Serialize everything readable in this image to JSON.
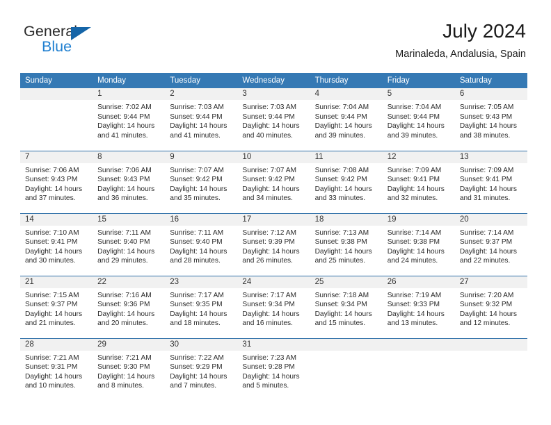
{
  "brand": {
    "name_part1": "General",
    "name_part2": "Blue",
    "accent_color": "#1f7fd0",
    "triangle_color": "#1565a8"
  },
  "header": {
    "title": "July 2024",
    "subtitle": "Marinaleda, Andalusia, Spain"
  },
  "calendar": {
    "header_bg": "#3579b4",
    "daynum_bg": "#f1f1f1",
    "weekdays": [
      "Sunday",
      "Monday",
      "Tuesday",
      "Wednesday",
      "Thursday",
      "Friday",
      "Saturday"
    ],
    "weeks": [
      [
        {
          "day": "",
          "sunrise": "",
          "sunset": "",
          "daylight_1": "",
          "daylight_2": ""
        },
        {
          "day": "1",
          "sunrise": "Sunrise: 7:02 AM",
          "sunset": "Sunset: 9:44 PM",
          "daylight_1": "Daylight: 14 hours",
          "daylight_2": "and 41 minutes."
        },
        {
          "day": "2",
          "sunrise": "Sunrise: 7:03 AM",
          "sunset": "Sunset: 9:44 PM",
          "daylight_1": "Daylight: 14 hours",
          "daylight_2": "and 41 minutes."
        },
        {
          "day": "3",
          "sunrise": "Sunrise: 7:03 AM",
          "sunset": "Sunset: 9:44 PM",
          "daylight_1": "Daylight: 14 hours",
          "daylight_2": "and 40 minutes."
        },
        {
          "day": "4",
          "sunrise": "Sunrise: 7:04 AM",
          "sunset": "Sunset: 9:44 PM",
          "daylight_1": "Daylight: 14 hours",
          "daylight_2": "and 39 minutes."
        },
        {
          "day": "5",
          "sunrise": "Sunrise: 7:04 AM",
          "sunset": "Sunset: 9:44 PM",
          "daylight_1": "Daylight: 14 hours",
          "daylight_2": "and 39 minutes."
        },
        {
          "day": "6",
          "sunrise": "Sunrise: 7:05 AM",
          "sunset": "Sunset: 9:43 PM",
          "daylight_1": "Daylight: 14 hours",
          "daylight_2": "and 38 minutes."
        }
      ],
      [
        {
          "day": "7",
          "sunrise": "Sunrise: 7:06 AM",
          "sunset": "Sunset: 9:43 PM",
          "daylight_1": "Daylight: 14 hours",
          "daylight_2": "and 37 minutes."
        },
        {
          "day": "8",
          "sunrise": "Sunrise: 7:06 AM",
          "sunset": "Sunset: 9:43 PM",
          "daylight_1": "Daylight: 14 hours",
          "daylight_2": "and 36 minutes."
        },
        {
          "day": "9",
          "sunrise": "Sunrise: 7:07 AM",
          "sunset": "Sunset: 9:42 PM",
          "daylight_1": "Daylight: 14 hours",
          "daylight_2": "and 35 minutes."
        },
        {
          "day": "10",
          "sunrise": "Sunrise: 7:07 AM",
          "sunset": "Sunset: 9:42 PM",
          "daylight_1": "Daylight: 14 hours",
          "daylight_2": "and 34 minutes."
        },
        {
          "day": "11",
          "sunrise": "Sunrise: 7:08 AM",
          "sunset": "Sunset: 9:42 PM",
          "daylight_1": "Daylight: 14 hours",
          "daylight_2": "and 33 minutes."
        },
        {
          "day": "12",
          "sunrise": "Sunrise: 7:09 AM",
          "sunset": "Sunset: 9:41 PM",
          "daylight_1": "Daylight: 14 hours",
          "daylight_2": "and 32 minutes."
        },
        {
          "day": "13",
          "sunrise": "Sunrise: 7:09 AM",
          "sunset": "Sunset: 9:41 PM",
          "daylight_1": "Daylight: 14 hours",
          "daylight_2": "and 31 minutes."
        }
      ],
      [
        {
          "day": "14",
          "sunrise": "Sunrise: 7:10 AM",
          "sunset": "Sunset: 9:41 PM",
          "daylight_1": "Daylight: 14 hours",
          "daylight_2": "and 30 minutes."
        },
        {
          "day": "15",
          "sunrise": "Sunrise: 7:11 AM",
          "sunset": "Sunset: 9:40 PM",
          "daylight_1": "Daylight: 14 hours",
          "daylight_2": "and 29 minutes."
        },
        {
          "day": "16",
          "sunrise": "Sunrise: 7:11 AM",
          "sunset": "Sunset: 9:40 PM",
          "daylight_1": "Daylight: 14 hours",
          "daylight_2": "and 28 minutes."
        },
        {
          "day": "17",
          "sunrise": "Sunrise: 7:12 AM",
          "sunset": "Sunset: 9:39 PM",
          "daylight_1": "Daylight: 14 hours",
          "daylight_2": "and 26 minutes."
        },
        {
          "day": "18",
          "sunrise": "Sunrise: 7:13 AM",
          "sunset": "Sunset: 9:38 PM",
          "daylight_1": "Daylight: 14 hours",
          "daylight_2": "and 25 minutes."
        },
        {
          "day": "19",
          "sunrise": "Sunrise: 7:14 AM",
          "sunset": "Sunset: 9:38 PM",
          "daylight_1": "Daylight: 14 hours",
          "daylight_2": "and 24 minutes."
        },
        {
          "day": "20",
          "sunrise": "Sunrise: 7:14 AM",
          "sunset": "Sunset: 9:37 PM",
          "daylight_1": "Daylight: 14 hours",
          "daylight_2": "and 22 minutes."
        }
      ],
      [
        {
          "day": "21",
          "sunrise": "Sunrise: 7:15 AM",
          "sunset": "Sunset: 9:37 PM",
          "daylight_1": "Daylight: 14 hours",
          "daylight_2": "and 21 minutes."
        },
        {
          "day": "22",
          "sunrise": "Sunrise: 7:16 AM",
          "sunset": "Sunset: 9:36 PM",
          "daylight_1": "Daylight: 14 hours",
          "daylight_2": "and 20 minutes."
        },
        {
          "day": "23",
          "sunrise": "Sunrise: 7:17 AM",
          "sunset": "Sunset: 9:35 PM",
          "daylight_1": "Daylight: 14 hours",
          "daylight_2": "and 18 minutes."
        },
        {
          "day": "24",
          "sunrise": "Sunrise: 7:17 AM",
          "sunset": "Sunset: 9:34 PM",
          "daylight_1": "Daylight: 14 hours",
          "daylight_2": "and 16 minutes."
        },
        {
          "day": "25",
          "sunrise": "Sunrise: 7:18 AM",
          "sunset": "Sunset: 9:34 PM",
          "daylight_1": "Daylight: 14 hours",
          "daylight_2": "and 15 minutes."
        },
        {
          "day": "26",
          "sunrise": "Sunrise: 7:19 AM",
          "sunset": "Sunset: 9:33 PM",
          "daylight_1": "Daylight: 14 hours",
          "daylight_2": "and 13 minutes."
        },
        {
          "day": "27",
          "sunrise": "Sunrise: 7:20 AM",
          "sunset": "Sunset: 9:32 PM",
          "daylight_1": "Daylight: 14 hours",
          "daylight_2": "and 12 minutes."
        }
      ],
      [
        {
          "day": "28",
          "sunrise": "Sunrise: 7:21 AM",
          "sunset": "Sunset: 9:31 PM",
          "daylight_1": "Daylight: 14 hours",
          "daylight_2": "and 10 minutes."
        },
        {
          "day": "29",
          "sunrise": "Sunrise: 7:21 AM",
          "sunset": "Sunset: 9:30 PM",
          "daylight_1": "Daylight: 14 hours",
          "daylight_2": "and 8 minutes."
        },
        {
          "day": "30",
          "sunrise": "Sunrise: 7:22 AM",
          "sunset": "Sunset: 9:29 PM",
          "daylight_1": "Daylight: 14 hours",
          "daylight_2": "and 7 minutes."
        },
        {
          "day": "31",
          "sunrise": "Sunrise: 7:23 AM",
          "sunset": "Sunset: 9:28 PM",
          "daylight_1": "Daylight: 14 hours",
          "daylight_2": "and 5 minutes."
        },
        {
          "day": "",
          "sunrise": "",
          "sunset": "",
          "daylight_1": "",
          "daylight_2": ""
        },
        {
          "day": "",
          "sunrise": "",
          "sunset": "",
          "daylight_1": "",
          "daylight_2": ""
        },
        {
          "day": "",
          "sunrise": "",
          "sunset": "",
          "daylight_1": "",
          "daylight_2": ""
        }
      ]
    ]
  }
}
